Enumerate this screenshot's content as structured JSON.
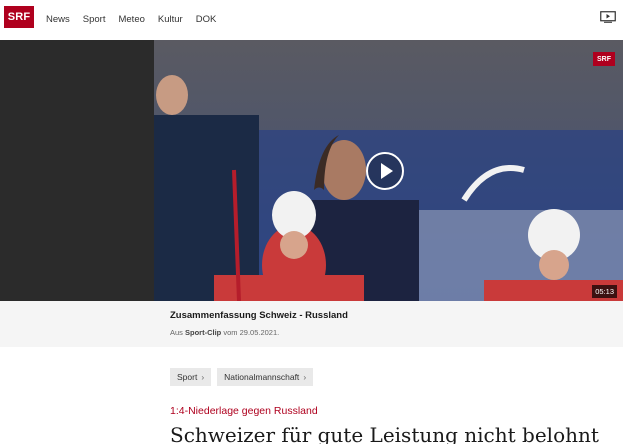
{
  "header": {
    "logo": "SRF",
    "nav": [
      "News",
      "Sport",
      "Meteo",
      "Kultur",
      "DOK"
    ],
    "tv_icon": "tv-play-icon"
  },
  "video": {
    "badge": "SRF",
    "duration": "05:13",
    "play_icon": "play-icon"
  },
  "caption": {
    "title": "Zusammenfassung Schweiz - Russland",
    "meta_prefix": "Aus ",
    "meta_source": "Sport-Clip",
    "meta_suffix": " vom 29.05.2021."
  },
  "tags": [
    "Sport",
    "Nationalmannschaft"
  ],
  "article": {
    "kicker": "1:4-Niederlage gegen Russland",
    "headline": "Schweizer für gute Leistung nicht belohnt"
  },
  "colors": {
    "brand": "#af001e"
  }
}
